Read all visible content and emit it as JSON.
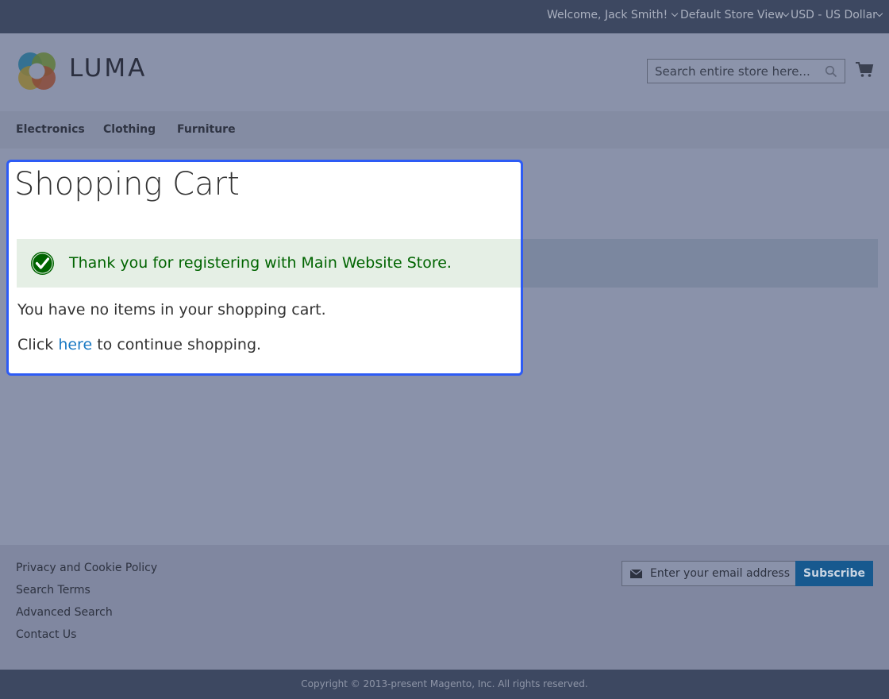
{
  "topbar": {
    "welcome": "Welcome, Jack Smith!",
    "store_view": "Default Store View",
    "currency": "USD - US Dollar"
  },
  "header": {
    "logo_text": "LUMA",
    "search_placeholder": "Search entire store here..."
  },
  "nav": {
    "items": [
      {
        "label": "Electronics"
      },
      {
        "label": "Clothing"
      },
      {
        "label": "Furniture"
      }
    ]
  },
  "main": {
    "title": "Shopping Cart",
    "success_message": "Thank you for registering with Main Website Store.",
    "empty_text": "You have no items in your shopping cart.",
    "continue_prefix": "Click",
    "continue_link": "here",
    "continue_suffix": "to continue shopping."
  },
  "footer": {
    "links": [
      {
        "label": "Privacy and Cookie Policy"
      },
      {
        "label": "Search Terms"
      },
      {
        "label": "Advanced Search"
      },
      {
        "label": "Contact Us"
      }
    ],
    "email_placeholder": "Enter your email address",
    "subscribe_label": "Subscribe",
    "copyright": "Copyright © 2013-present Magento, Inc. All rights reserved."
  },
  "colors": {
    "accent": "#2d5bf5",
    "link": "#1979c3",
    "success": "#006400",
    "subscribe_bg": "#17598f"
  },
  "icons": [
    "chevron-down-icon",
    "luma-logo-icon",
    "search-icon",
    "cart-icon",
    "check-icon",
    "envelope-icon"
  ]
}
